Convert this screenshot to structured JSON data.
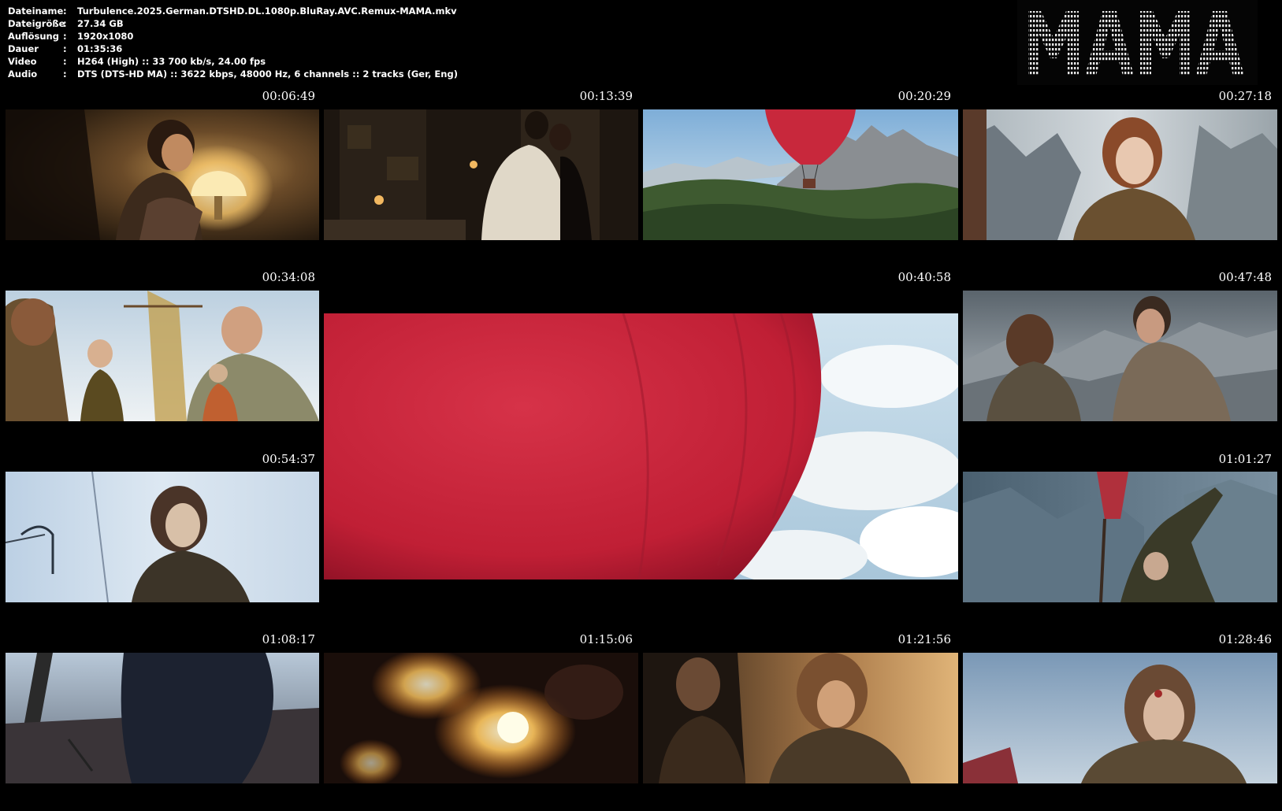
{
  "info": {
    "rows": [
      {
        "label": "Dateiname",
        "sep": ":",
        "value": "Turbulence.2025.German.DTSHD.DL.1080p.BluRay.AVC.Remux-MAMA.mkv"
      },
      {
        "label": "Dateigröße",
        "sep": ":",
        "value": "27.34 GB"
      },
      {
        "label": "Auflösung",
        "sep": ":",
        "value": "1920x1080"
      },
      {
        "label": "Dauer",
        "sep": ":",
        "value": "01:35:36"
      },
      {
        "label": "Video",
        "sep": ":",
        "value": "H264 (High) :: 33 700 kb/s, 24.00 fps"
      },
      {
        "label": "Audio",
        "sep": ":",
        "value": "DTS (DTS-HD MA) :: 3622 kbps, 48000 Hz, 6 channels :: 2 tracks (Ger, Eng)"
      }
    ]
  },
  "logo": {
    "name": "ascii-art-logo",
    "text": "MAMA"
  },
  "thumbnails": [
    {
      "timestamp": "00:06:49",
      "scene": "woman-with-lamp"
    },
    {
      "timestamp": "00:13:39",
      "scene": "couple-embrace-room"
    },
    {
      "timestamp": "00:20:29",
      "scene": "balloon-over-mountains"
    },
    {
      "timestamp": "00:27:18",
      "scene": "redhead-woman-mountains"
    },
    {
      "timestamp": "00:34:08",
      "scene": "group-at-balloon-basket"
    },
    {
      "timestamp": "00:40:58",
      "scene": "red-balloon-clouds"
    },
    {
      "timestamp": "00:47:48",
      "scene": "two-people-mountains"
    },
    {
      "timestamp": "00:54:37",
      "scene": "woman-in-fog"
    },
    {
      "timestamp": "01:01:27",
      "scene": "person-reaching-up"
    },
    {
      "timestamp": "01:08:17",
      "scene": "basket-dark-figure"
    },
    {
      "timestamp": "01:15:06",
      "scene": "burner-flames"
    },
    {
      "timestamp": "01:21:56",
      "scene": "two-people-golden-light"
    },
    {
      "timestamp": "01:28:46",
      "scene": "injured-woman-sky"
    }
  ],
  "colors": {
    "background": "#000000",
    "text": "#ffffff",
    "balloon_red": "#c41f35"
  }
}
